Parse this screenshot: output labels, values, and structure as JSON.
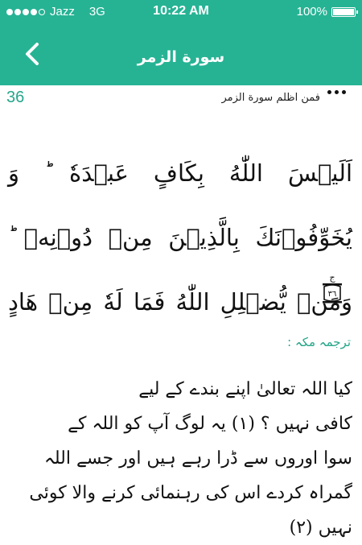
{
  "status_bar": {
    "carrier": "Jazz",
    "network": "3G",
    "time": "10:22 AM",
    "battery": "100%"
  },
  "nav": {
    "title": "سورة الزمر",
    "back_icon": "chevron-left-icon"
  },
  "info": {
    "page_number": "36",
    "juz_info": "فمن اظلم سورة الزمر",
    "more_icon": "more-dots-icon"
  },
  "ayah": {
    "text": "اَلَيۡسَ اللّٰهُ بِكَافٍ عَبۡدَهٗ ؕ وَ يُخَوِّفُوۡنَكَ بِالَّذِيۡنَ مِنۡ دُوۡنِهٖ ؕ وَمَنۡ يُّضۡلِلِ اللّٰهُ فَمَا لَهٗ مِنۡ هَادٍ",
    "marker_letter": "ج",
    "marker_number": "٣٦"
  },
  "translation": {
    "label": "ترجمہ مکہ :",
    "lines": [
      "کیا اللہ تعالیٰ اپنے بندے کے لیے",
      "کافی نہیں ؟ (۱) یہ لوگ آپ کو اللہ کے",
      "سوا اوروں سے ڈرا رہے ہیں اور جسے اللہ",
      "گمراہ کردے اس کی رہنمائی کرنے والا کوئی",
      "نہیں (۲)"
    ]
  },
  "colors": {
    "accent": "#26b394",
    "accent_text": "#26a68a"
  }
}
